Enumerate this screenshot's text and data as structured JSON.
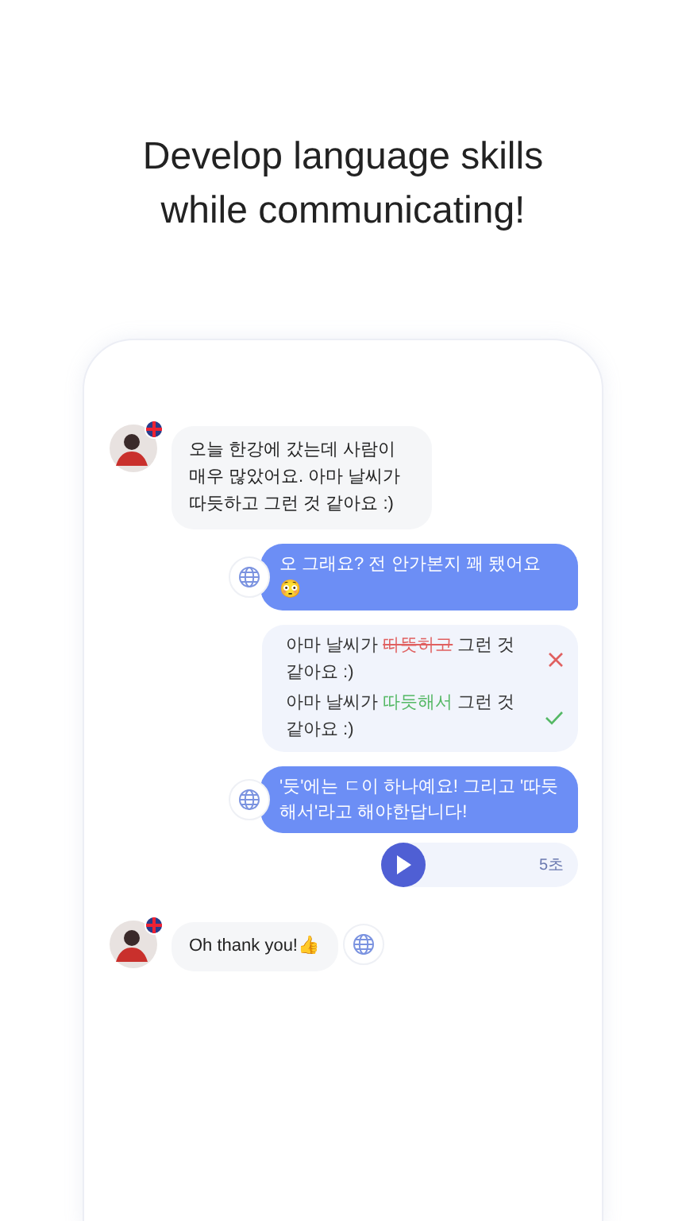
{
  "headline": [
    "Develop language skills",
    "while communicating!"
  ],
  "messages": [
    {
      "kind": "received",
      "text": "오늘 한강에 갔는데 사람이 매우 많았어요. 아마 날씨가 따듯하고 그런 것 같아요 :)",
      "translate": false
    },
    {
      "kind": "sent",
      "text": "오 그래요? 전 안가본지 꽤 됐어요😳",
      "translate": true
    },
    {
      "kind": "correction",
      "lines": [
        {
          "correct": false,
          "before": "아마 날씨가 ",
          "mark": "따뜻하고",
          "after": " 그런 것 같아요 :)"
        },
        {
          "correct": true,
          "before": "아마 날씨가 ",
          "mark": "따듯해서",
          "after": " 그런 것 같아요 :)"
        }
      ]
    },
    {
      "kind": "sent",
      "text": "'듯'에는 ㄷ이 하나예요! 그리고 '따듯해서'라고 해야한답니다!",
      "translate": true
    },
    {
      "kind": "voice",
      "duration": "5초"
    },
    {
      "kind": "received",
      "text": "Oh thank you!👍",
      "translate": true
    }
  ]
}
